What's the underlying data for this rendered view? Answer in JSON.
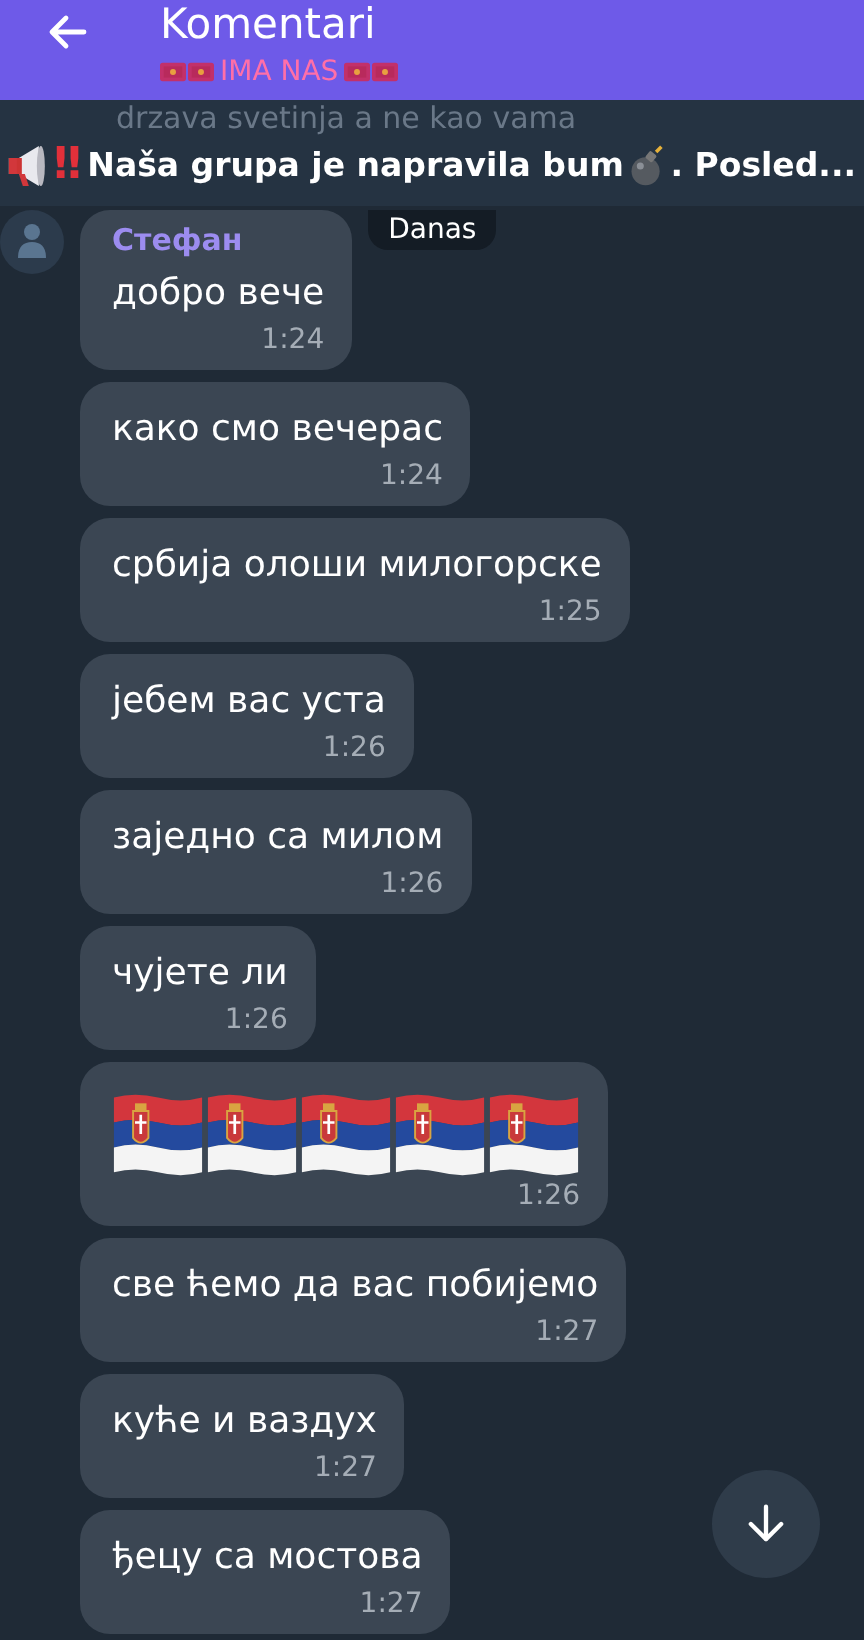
{
  "header": {
    "title": "Komentari",
    "subtitle": {
      "icons_before": [
        {
          "kind": "flag"
        },
        {
          "kind": "flag"
        }
      ],
      "text": "IMA NAS",
      "icons_after": [
        {
          "kind": "flag"
        },
        {
          "kind": "flag"
        }
      ]
    }
  },
  "faded_text": "drzava svetinja a ne kao vama",
  "pinned": {
    "mark": "‼",
    "text": "Naša grupa je napravila bum",
    "after": ". Posled..."
  },
  "date_chip": "Danas",
  "messages": [
    {
      "kind": "text",
      "sender": "Стефан",
      "text": "добро вече",
      "time": "1:24"
    },
    {
      "kind": "text",
      "text": "како смо вечерас",
      "time": "1:24"
    },
    {
      "kind": "text",
      "text": "србија олоши милогорске",
      "time": "1:25"
    },
    {
      "kind": "text",
      "text": "јебем вас уста",
      "time": "1:26"
    },
    {
      "kind": "text",
      "text": "заједно са милом",
      "time": "1:26"
    },
    {
      "kind": "text",
      "text": "чујете ли",
      "time": "1:26"
    },
    {
      "kind": "flags",
      "flags": [
        {
          "kind": "serbia"
        },
        {
          "kind": "serbia"
        },
        {
          "kind": "serbia"
        },
        {
          "kind": "serbia"
        },
        {
          "kind": "serbia"
        }
      ],
      "time": "1:26"
    },
    {
      "kind": "text",
      "text": "све ћемо да вас побијемо",
      "time": "1:27"
    },
    {
      "kind": "text",
      "text": "куће и ваздух",
      "time": "1:27"
    },
    {
      "kind": "text",
      "text": "ђецу са мостова",
      "time": "1:27"
    }
  ]
}
